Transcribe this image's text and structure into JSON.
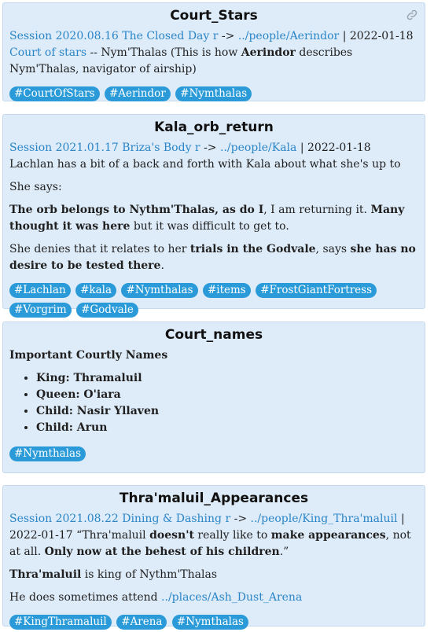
{
  "cards": [
    {
      "title": "Court_Stars",
      "session_link": "Session 2020.08.16 The Closed Day r",
      "arrow": "->",
      "people_link": "../people/Aerindor",
      "sep": "|",
      "date": "2022-01-18",
      "court_link": "Court of stars",
      "text_1": "-- Nym'Thalas (This is how ",
      "bold_1": "Aerindor",
      "text_2": " describes Nym'Thalas, navigator of airship)",
      "tags": [
        "#CourtOfStars",
        "#Aerindor",
        "#Nymthalas"
      ]
    },
    {
      "title": "Kala_orb_return",
      "session_link": "Session 2021.01.17 Briza's Body r",
      "arrow": "->",
      "people_link": "../people/Kala",
      "sep": "|",
      "date_text": "2022-01-18 Lachlan has a bit of a back and forth with Kala about what she's up to",
      "she_says": "She says:",
      "q_bold_1": "The orb belongs to Nythm'Thalas, as do I",
      "q_text_1": ", I am returning it. ",
      "q_bold_2": "Many thought it was here",
      "q_text_2": " but it was difficult to get to.",
      "d_text_1": "She denies that it relates to her ",
      "d_bold_1": "trials in the Godvale",
      "d_text_2": ", says ",
      "d_bold_2": "she has no desire to be tested there",
      "d_text_3": ".",
      "tags": [
        "#Lachlan",
        "#kala",
        "#Nymthalas",
        "#items",
        "#FrostGiantFortress",
        "#Vorgrim",
        "#Godvale"
      ]
    },
    {
      "title": "Court_names",
      "subtitle": "Important Courtly Names",
      "names": [
        "King: Thramaluil",
        "Queen: O'iara",
        "Child: Nasir Yllaven",
        "Child: Arun"
      ],
      "tags": [
        "#Nymthalas"
      ]
    },
    {
      "title": "Thra'maluil_Appearances",
      "session_link": "Session 2021.08.22 Dining & Dashing r",
      "arrow": "->",
      "people_link": "../people/King_Thra'maluil",
      "sep": "|",
      "t_text_1": "2022-01-17 “Thra'maluil ",
      "t_bold_1": "doesn't",
      "t_text_2": " really like to ",
      "t_bold_2": "make appearances",
      "t_text_3": ", not at all. ",
      "t_bold_3": "Only now at the behest of his children",
      "t_text_4": ".”",
      "k_bold": "Thra'maluil",
      "k_text": " is king of Nythm'Thalas",
      "a_text": "He does sometimes attend ",
      "a_link": "../places/Ash_Dust_Arena",
      "tags": [
        "#KingThramaluil",
        "#Arena",
        "#Nymthalas"
      ]
    }
  ]
}
